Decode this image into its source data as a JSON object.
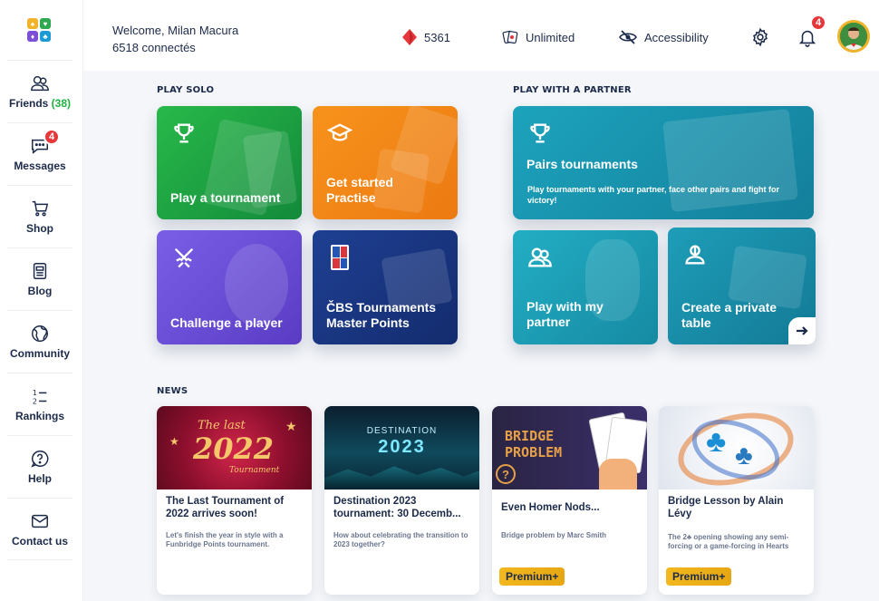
{
  "sidebar": {
    "items": [
      {
        "label": "Friends",
        "count": "(38)",
        "icon": "friends-icon"
      },
      {
        "label": "Messages",
        "badge": "4",
        "icon": "messages-icon"
      },
      {
        "label": "Shop",
        "icon": "cart-icon"
      },
      {
        "label": "Blog",
        "icon": "blog-icon"
      },
      {
        "label": "Community",
        "icon": "globe-icon"
      },
      {
        "label": "Rankings",
        "icon": "rankings-icon"
      },
      {
        "label": "Help",
        "icon": "help-icon"
      },
      {
        "label": "Contact us",
        "icon": "mail-icon"
      }
    ]
  },
  "header": {
    "welcome": "Welcome, Milan Macura",
    "connected": "6518 connectés",
    "diamonds": "5361",
    "unlimited": "Unlimited",
    "accessibility": "Accessibility",
    "notifications_badge": "4"
  },
  "solo": {
    "title": "PLAY SOLO",
    "cards": [
      {
        "label": "Play a tournament",
        "icon": "trophy-icon"
      },
      {
        "label_line1": "Get started",
        "label_line2": "Practise",
        "icon": "graduation-cap-icon"
      },
      {
        "label": "Challenge a player",
        "icon": "swords-icon"
      },
      {
        "label_line1": "ČBS Tournaments",
        "label_line2": "Master Points",
        "icon": "cbs-logo-icon"
      }
    ]
  },
  "partner": {
    "title": "PLAY WITH A PARTNER",
    "pairs_title": "Pairs tournaments",
    "pairs_desc": "Play tournaments with your partner, face other pairs and fight for victory!",
    "play_partner_line1": "Play with my",
    "play_partner_line2": "partner",
    "private_line1": "Create a private",
    "private_line2": "table"
  },
  "news": {
    "title": "NEWS",
    "items": [
      {
        "title": "The Last Tournament of 2022 arrives soon!",
        "desc": "Let's finish the year in style with a Funbridge Points tournament.",
        "img_text1": "The last",
        "img_text2": "2022",
        "img_text3": "Tournament"
      },
      {
        "title": "Destination 2023 tournament: 30 Decemb...",
        "desc": "How about celebrating the transition to 2023 together?",
        "img_text1": "DESTINATION",
        "img_text2": "2023"
      },
      {
        "title": "Even Homer Nods...",
        "desc": "Bridge problem by Marc Smith",
        "premium": "Premium+",
        "img_text1": "BRIDGE",
        "img_text2": "PROBLEM",
        "img_text3": "?"
      },
      {
        "title": "Bridge Lesson by Alain Lévy",
        "desc": "The 2♣ opening showing any semi-forcing or a game-forcing in Hearts",
        "premium": "Premium+"
      }
    ]
  },
  "colors": {
    "green": "#1fb141",
    "orange": "#f08a1c",
    "purple": "#6f52d8",
    "navy": "#1f3c8e",
    "teal": "#1a97b0",
    "badge_red": "#e8373a",
    "premium": "#f2b81e"
  }
}
